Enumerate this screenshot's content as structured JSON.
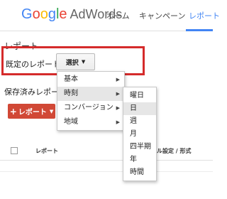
{
  "header": {
    "brand": {
      "G": "G",
      "o1": "o",
      "o2": "o",
      "g": "g",
      "l": "l",
      "e": "e",
      "product": "AdWords"
    },
    "nav": [
      "ホーム",
      "キャンペーン",
      "レポート"
    ]
  },
  "page": {
    "title": "レポート",
    "preset_label": "既定のレポート",
    "select_button": "選択",
    "saved_label": "保存済みレポート",
    "report_button": "レポート"
  },
  "table": {
    "col_report": "レポート",
    "col_settings": "ル設定 / 形式"
  },
  "menu": {
    "items": [
      "基本",
      "時刻",
      "コンバージョン",
      "地域"
    ]
  },
  "submenu": {
    "items": [
      "曜日",
      "日",
      "週",
      "月",
      "四半期",
      "年",
      "時間"
    ]
  },
  "colors": {
    "accent": "#4285f4",
    "highlight_border": "#d52b2b",
    "report_button": "#d14836"
  }
}
